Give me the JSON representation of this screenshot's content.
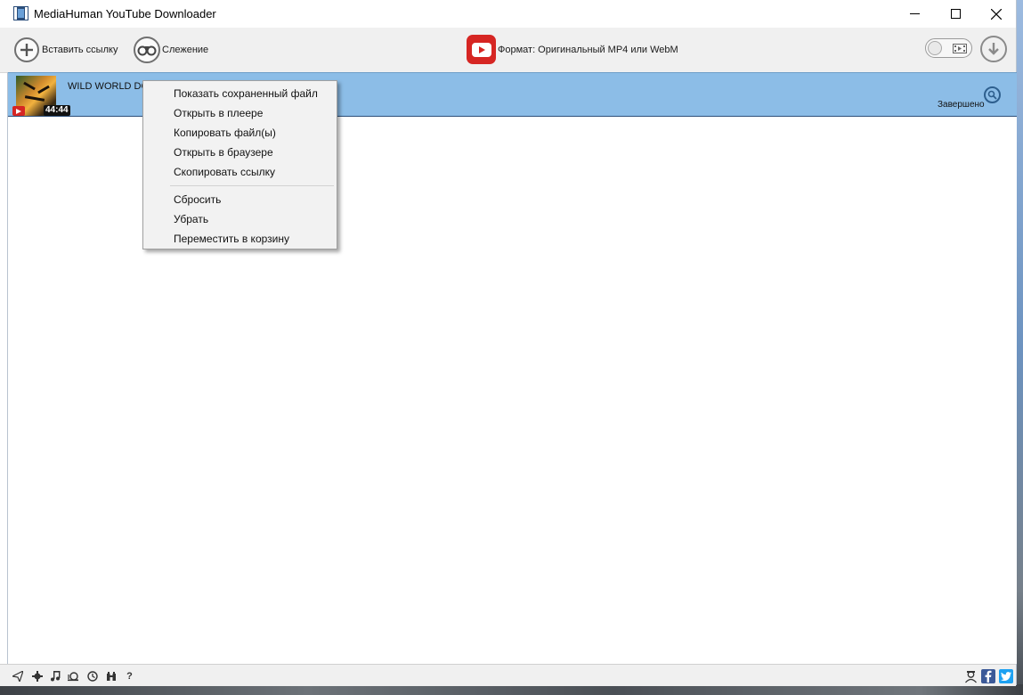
{
  "window": {
    "title": "MediaHuman YouTube Downloader"
  },
  "toolbar": {
    "paste_label": "Вставить ссылку",
    "tracking_label": "Слежение",
    "format_label": "Формат: Оригинальный MP4 или WebM"
  },
  "download": {
    "title": "WILD WORLD DO",
    "duration": "44:44",
    "status": "Завершено"
  },
  "context_menu": {
    "items": [
      "Показать сохраненный файл",
      "Открыть в плеере",
      "Копировать файл(ы)",
      "Открыть в браузере",
      "Скопировать ссылку",
      "Сбросить",
      "Убрать",
      "Переместить в корзину"
    ]
  },
  "statusbar": {
    "help": "?"
  },
  "colors": {
    "accent_row": "#8cbde7",
    "youtube_red": "#d62623",
    "facebook": "#3b5998",
    "twitter": "#1da1f2"
  }
}
